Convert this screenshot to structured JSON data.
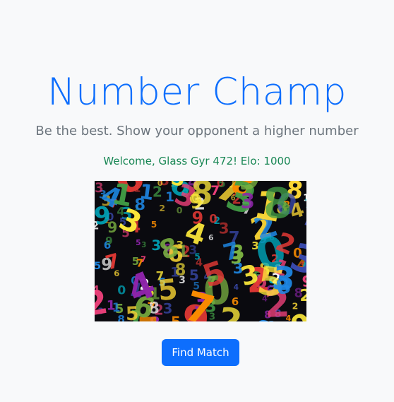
{
  "page": {
    "title": "Number Champ",
    "subtitle": "Be the best. Show your opponent a higher number",
    "welcome": "Welcome, Glass Gyr 472! Elo: 1000"
  },
  "hero_image": {
    "description_name": "colorful-numbers-image",
    "digits": [
      "4",
      "5",
      "8",
      "2",
      "3",
      "5",
      "7",
      "1",
      "3",
      "0",
      "2",
      "9",
      "5",
      "7",
      "6",
      "2",
      "8",
      "3",
      "1",
      "4",
      "3",
      "6",
      "0",
      "5",
      "2",
      "8",
      "3",
      "9",
      "1",
      "7",
      "5",
      "4",
      "0",
      "3",
      "2",
      "6",
      "8",
      "1",
      "7",
      "5",
      "3",
      "9",
      "2",
      "4",
      "6",
      "0",
      "8",
      "1",
      "3",
      "5",
      "7",
      "2",
      "9",
      "4",
      "3",
      "6",
      "1",
      "8",
      "0",
      "5"
    ],
    "palette": [
      "#e53935",
      "#fdd835",
      "#1e88e5",
      "#43a047",
      "#fb8c00",
      "#8e24aa",
      "#00acc1",
      "#ec407a",
      "#7cb342",
      "#ffeb3b",
      "#3949ab",
      "#ffffff"
    ]
  },
  "actions": {
    "find_match_label": "Find Match"
  },
  "colors": {
    "title": "#0d6efd",
    "subtitle": "#6c757d",
    "welcome": "#198754",
    "button_bg": "#0d6efd",
    "background": "#f8f9fa"
  }
}
